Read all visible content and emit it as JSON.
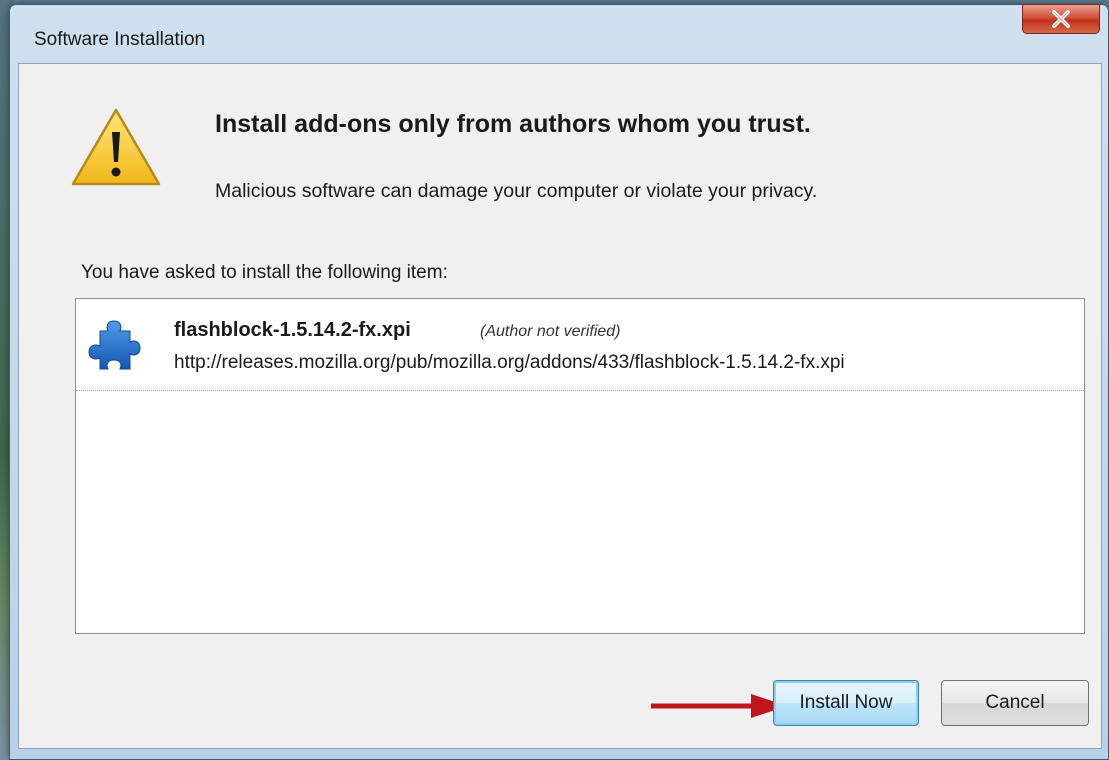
{
  "window": {
    "title": "Software Installation",
    "close_symbol": "X"
  },
  "dialog": {
    "heading": "Install add-ons only from authors whom you trust.",
    "warning": "Malicious software can damage your computer or violate your privacy.",
    "list_label": "You have asked to install the following item:",
    "items": [
      {
        "name": "flashblock-1.5.14.2-fx.xpi",
        "author_status": "(Author not verified)",
        "url": "http://releases.mozilla.org/pub/mozilla.org/addons/433/flashblock-1.5.14.2-fx.xpi",
        "icon": "puzzle-piece-icon"
      }
    ]
  },
  "buttons": {
    "install": "Install Now",
    "cancel": "Cancel"
  },
  "icons": {
    "warning": "warning-triangle-icon",
    "close": "close-icon",
    "annotation": "red-arrow-icon"
  },
  "colors": {
    "warning_yellow": "#f7cf2e",
    "puzzle_blue": "#1f6fd0",
    "close_red": "#c2321a",
    "arrow_red": "#c0161b",
    "focus_blue": "#3c7fb1"
  }
}
